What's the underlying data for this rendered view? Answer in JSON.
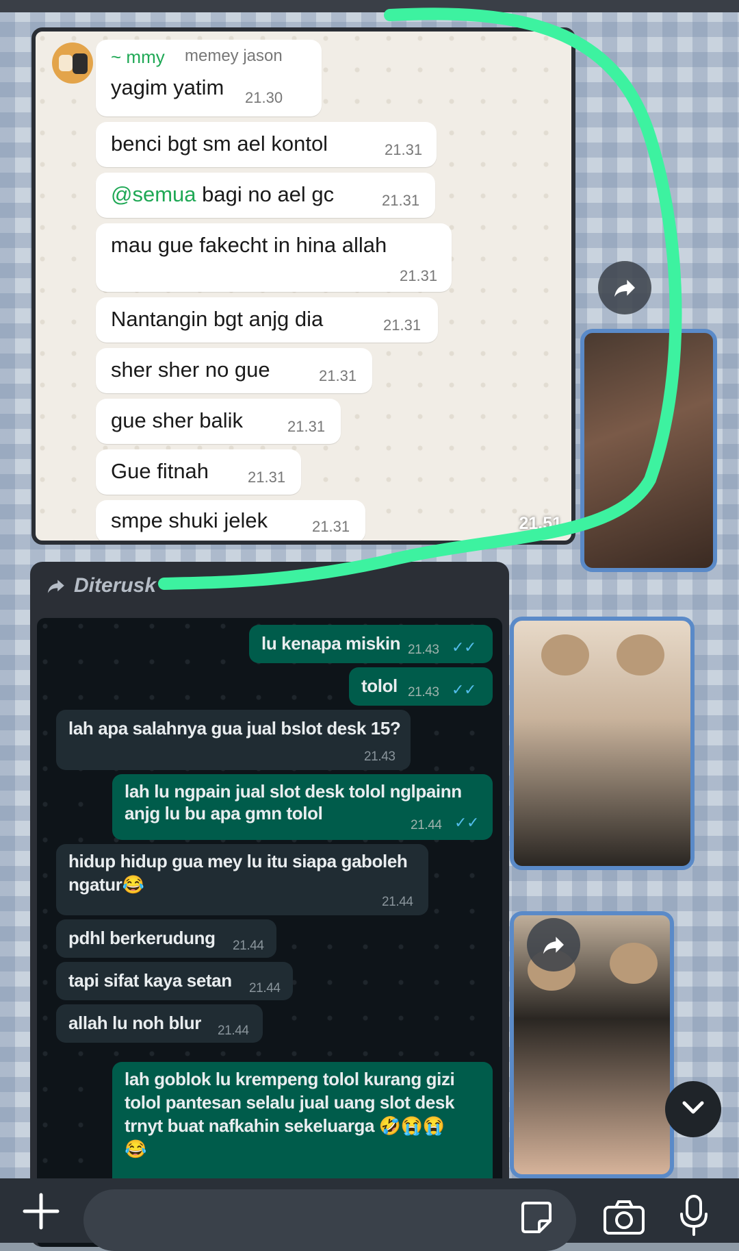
{
  "screenshot1": {
    "sender_name": "~ mmy",
    "sender_sub": "memey jason",
    "messages": [
      {
        "text": "yagim yatim",
        "time": "21.30"
      },
      {
        "text": "benci bgt sm ael kontol",
        "time": "21.31"
      },
      {
        "mention": "@semua",
        "text": " bagi no ael gc",
        "time": "21.31"
      },
      {
        "text": "mau gue fakecht in hina allah",
        "time": "21.31"
      },
      {
        "text": "Nantangin bgt anjg dia",
        "time": "21.31"
      },
      {
        "text": "sher sher no gue",
        "time": "21.31"
      },
      {
        "text": "gue sher balik",
        "time": "21.31"
      },
      {
        "text": "Gue fitnah",
        "time": "21.31"
      },
      {
        "text": "smpe shuki jelek",
        "time": "21.31"
      }
    ],
    "image_time": "21.51"
  },
  "forward_label": "Diterusk",
  "screenshot2": {
    "messages": [
      {
        "dir": "out",
        "text": "lu kenapa miskin",
        "time": "21.43"
      },
      {
        "dir": "out",
        "text": "tolol",
        "time": "21.43"
      },
      {
        "dir": "in",
        "text": "lah apa salahnya gua jual bslot desk 15?",
        "time": "21.43"
      },
      {
        "dir": "out",
        "text1": "lah lu ngpain jual slot desk tolol nglpainn",
        "text2": "anjg lu bu apa gmn tolol",
        "time": "21.44"
      },
      {
        "dir": "in",
        "text1": "hidup hidup gua mey lu itu siapa gaboleh",
        "text2": "ngatur😂",
        "time": "21.44"
      },
      {
        "dir": "in",
        "text": "pdhl berkerudung",
        "time": "21.44"
      },
      {
        "dir": "in",
        "text": "tapi sifat kaya setan",
        "time": "21.44"
      },
      {
        "dir": "in",
        "text": "allah lu noh blur",
        "time": "21.44"
      },
      {
        "dir": "out",
        "text1": "lah goblok lu krempeng tolol kurang gizi",
        "text2": "tolol pantesan selalu jual uang slot desk",
        "text3": "trnyt buat nafkahin sekeluarga 🤣😭😭",
        "text4": "😂"
      }
    ]
  },
  "composer": {
    "placeholder": ""
  },
  "colors": {
    "accent_green": "#1fa855",
    "scribble": "#3df2a0",
    "outgoing": "#005c4b",
    "incoming": "#202c33"
  }
}
